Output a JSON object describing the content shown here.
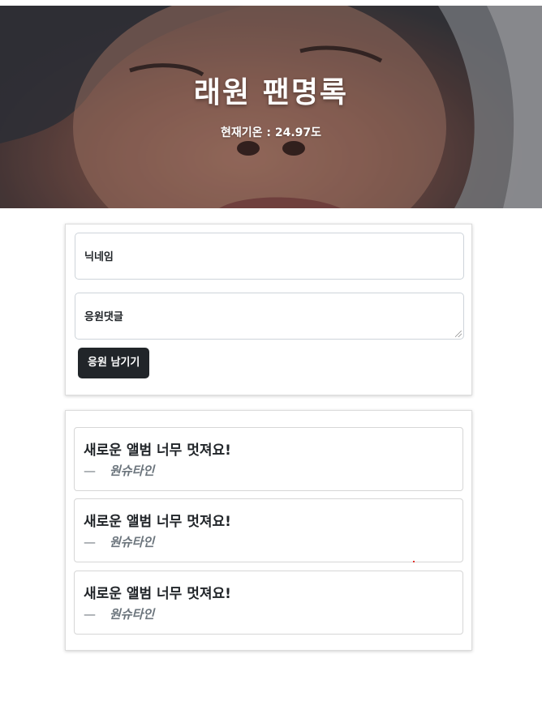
{
  "banner": {
    "title": "래원 팬명록",
    "temperature": "현재기온 : 24.97도"
  },
  "form": {
    "nickname_placeholder": "닉네임",
    "comment_placeholder": "응원댓글",
    "submit_label": "응원 남기기"
  },
  "comments": [
    {
      "text": "새로운 앨범 너무 멋져요!",
      "dash": "—",
      "author": "원슈타인"
    },
    {
      "text": "새로운 앨범 너무 멋져요!",
      "dash": "—",
      "author": "원슈타인"
    },
    {
      "text": "새로운 앨범 너무 멋져요!",
      "dash": "—",
      "author": "원슈타인"
    }
  ],
  "colors": {
    "button_bg": "#212529",
    "author_text": "#6c757d"
  }
}
